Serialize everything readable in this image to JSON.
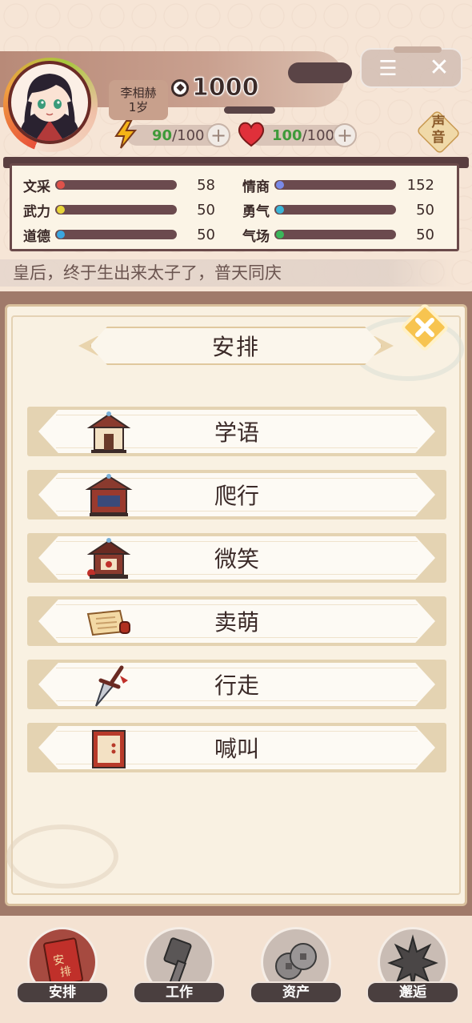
{
  "player": {
    "name": "李相赫",
    "age": "1岁",
    "coins": "1000",
    "energy_current": "90",
    "energy_max": "/100",
    "health_current": "100",
    "health_max": "/100"
  },
  "top_menu": {
    "sound_label_line1": "声",
    "sound_label_line2": "音"
  },
  "attributes": [
    {
      "label": "文采",
      "value": "58",
      "dot_color": "#e0524a"
    },
    {
      "label": "情商",
      "value": "152",
      "dot_color": "#7a8ae8"
    },
    {
      "label": "武力",
      "value": "50",
      "dot_color": "#e8d63a"
    },
    {
      "label": "勇气",
      "value": "50",
      "dot_color": "#3ab6d8"
    },
    {
      "label": "道德",
      "value": "50",
      "dot_color": "#3aa6e0"
    },
    {
      "label": "气场",
      "value": "50",
      "dot_color": "#3ab65a"
    }
  ],
  "marquee": "皇后，终于生出来太子了，普天同庆",
  "dialog": {
    "title": "安排",
    "actions": [
      {
        "label": "学语",
        "icon": "school-house-icon"
      },
      {
        "label": "爬行",
        "icon": "pavilion-icon"
      },
      {
        "label": "微笑",
        "icon": "festival-stall-icon"
      },
      {
        "label": "卖萌",
        "icon": "scroll-icon"
      },
      {
        "label": "行走",
        "icon": "dagger-icon"
      },
      {
        "label": "喊叫",
        "icon": "red-door-icon"
      }
    ]
  },
  "bottom_nav": [
    {
      "label": "安排",
      "icon": "red-book-icon",
      "active": true
    },
    {
      "label": "工作",
      "icon": "hammer-icon",
      "active": false
    },
    {
      "label": "资产",
      "icon": "coins-icon",
      "active": false
    },
    {
      "label": "邂逅",
      "icon": "maple-leaf-icon",
      "active": false
    }
  ],
  "colors": {
    "accent_brown": "#3b2a28",
    "energy_green": "#3f9a3a",
    "active_nav": "#a64a40"
  }
}
